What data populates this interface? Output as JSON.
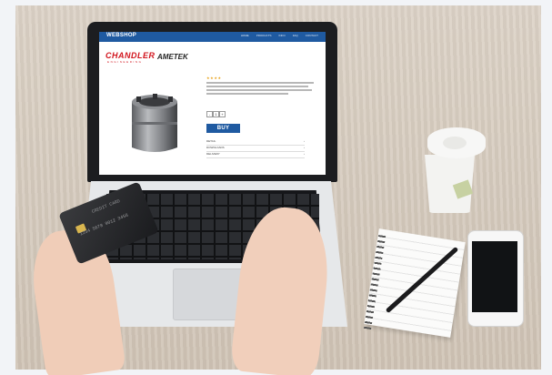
{
  "webshop": {
    "brand": "WEBSHOP",
    "nav_links": [
      "HOME",
      "PRODUCTS",
      "INFO",
      "FAQ",
      "CONTACT"
    ],
    "logo_chandler": "CHANDLER",
    "logo_engineering": "ENGINEERING",
    "logo_ametek": "AMETEK",
    "rating": "★★★★",
    "quantity": "1",
    "qty_minus": "-",
    "qty_plus": "+",
    "buy_label": "BUY",
    "specs": [
      "DETAIL",
      "DOWNLOADS",
      "DELIVERY"
    ],
    "spec_arrow": "›"
  },
  "credit_card": {
    "name": "CREDIT CARD",
    "number": "1234 5678 9012 3456"
  },
  "colors": {
    "nav_blue": "#1f5aa1",
    "chandler_red": "#d2151e",
    "desk": "#d6cbbd"
  }
}
